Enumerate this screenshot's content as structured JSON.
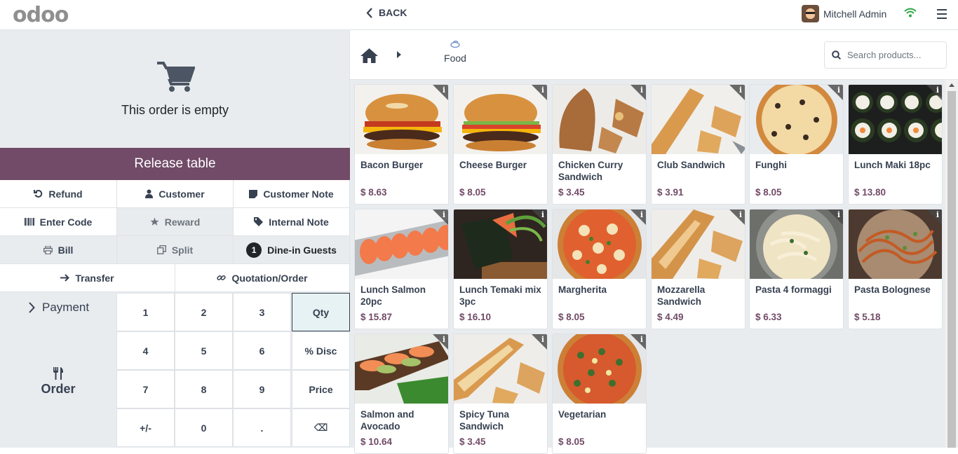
{
  "topbar": {
    "logo": "odoo",
    "back_label": "BACK",
    "user_name": "Mitchell Admin"
  },
  "order": {
    "empty_text": "This order is empty",
    "release_label": "Release table"
  },
  "controls": {
    "refund": "Refund",
    "customer": "Customer",
    "customer_note": "Customer Note",
    "enter_code": "Enter Code",
    "reward": "Reward",
    "internal_note": "Internal Note",
    "bill": "Bill",
    "split": "Split",
    "guests_count": "1",
    "dine_in_guests": "Dine-in Guests",
    "transfer": "Transfer",
    "quotation_order": "Quotation/Order"
  },
  "actions": {
    "payment": "Payment",
    "order": "Order"
  },
  "numpad": [
    "1",
    "2",
    "3",
    "Qty",
    "4",
    "5",
    "6",
    "% Disc",
    "7",
    "8",
    "9",
    "Price",
    "+/-",
    "0",
    ".",
    "⌫"
  ],
  "breadcrumb": {
    "category": "Food"
  },
  "search": {
    "placeholder": "Search products..."
  },
  "products": [
    {
      "name": "Bacon Burger",
      "price": "$ 8.63"
    },
    {
      "name": "Cheese Burger",
      "price": "$ 8.05"
    },
    {
      "name": "Chicken Curry Sandwich",
      "price": "$ 3.45"
    },
    {
      "name": "Club Sandwich",
      "price": "$ 3.91"
    },
    {
      "name": "Funghi",
      "price": "$ 8.05"
    },
    {
      "name": "Lunch Maki 18pc",
      "price": "$ 13.80"
    },
    {
      "name": "Lunch Salmon 20pc",
      "price": "$ 15.87"
    },
    {
      "name": "Lunch Temaki mix 3pc",
      "price": "$ 16.10"
    },
    {
      "name": "Margherita",
      "price": "$ 8.05"
    },
    {
      "name": "Mozzarella Sandwich",
      "price": "$ 4.49"
    },
    {
      "name": "Pasta 4 formaggi",
      "price": "$ 6.33"
    },
    {
      "name": "Pasta Bolognese",
      "price": "$ 5.18"
    },
    {
      "name": "Salmon and Avocado",
      "price": "$ 10.64"
    },
    {
      "name": "Spicy Tuna Sandwich",
      "price": "$ 3.45"
    },
    {
      "name": "Vegetarian",
      "price": "$ 8.05"
    }
  ],
  "colors": {
    "brand": "#714B67",
    "wifi": "#28a745"
  }
}
